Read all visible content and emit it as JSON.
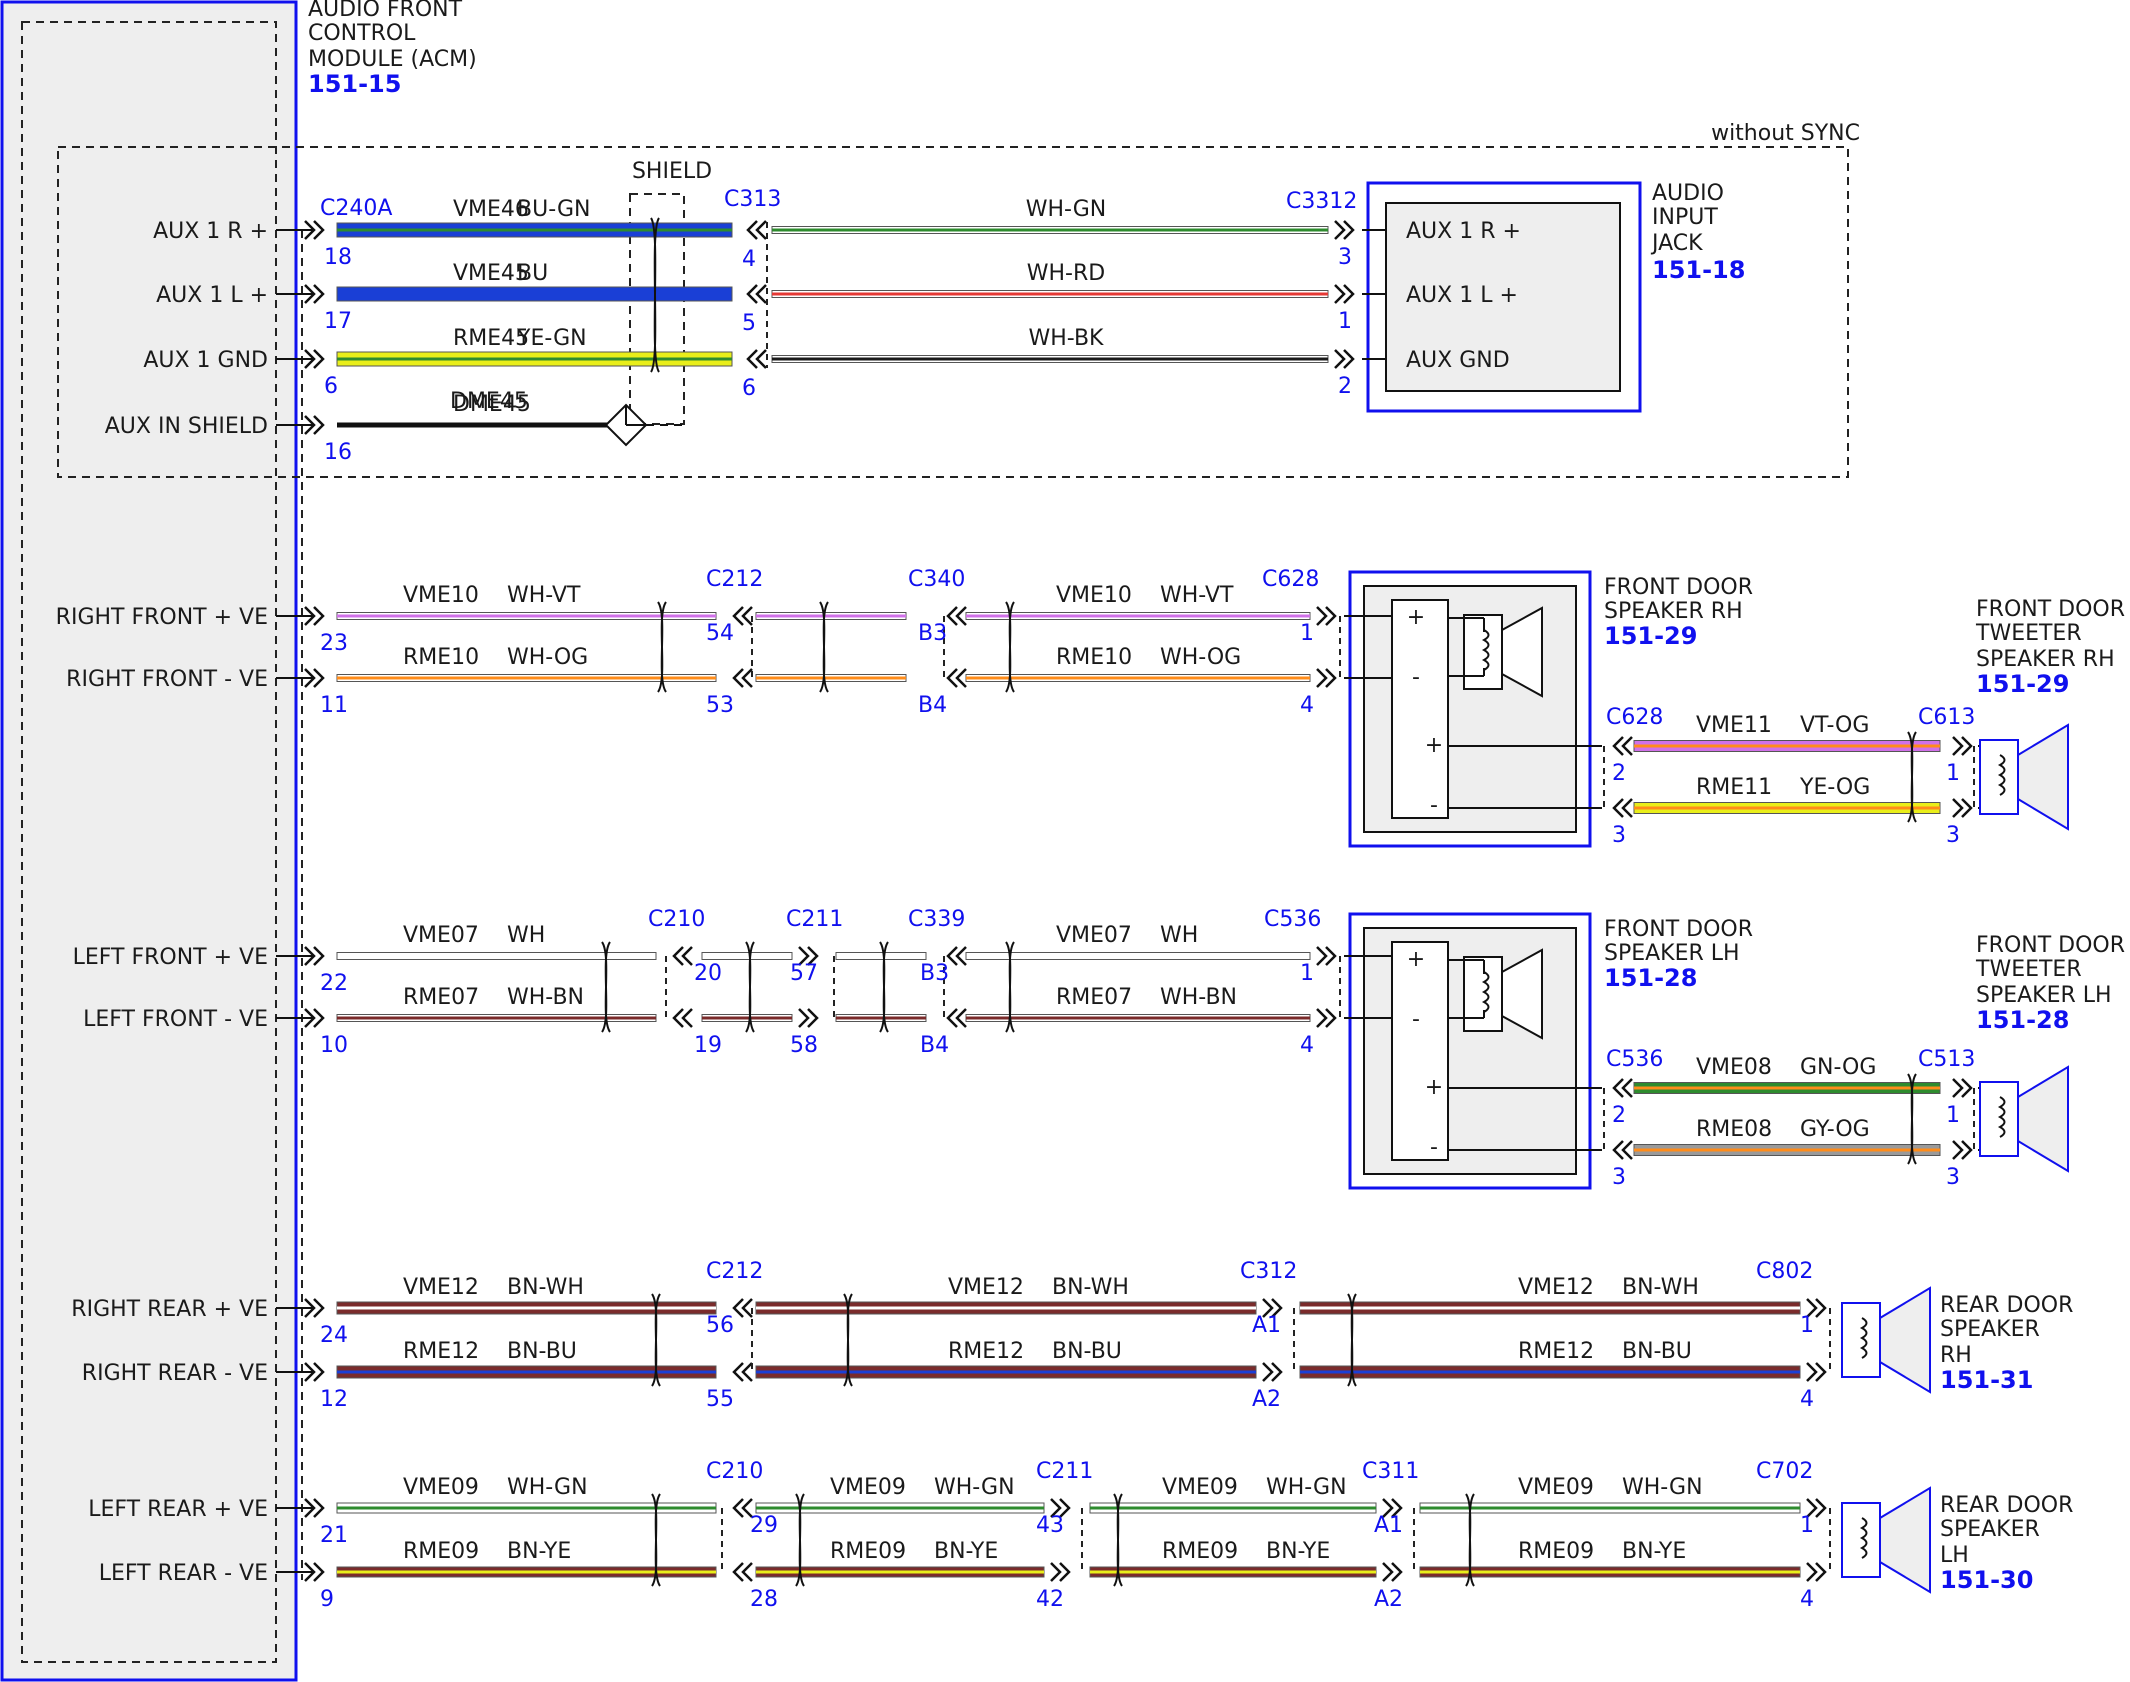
{
  "colors": {
    "WH": "#ffffff",
    "GN": "#2e8b2e",
    "RD": "#e53935",
    "BK": "#1a1a1a",
    "BU": "#1a3fd6",
    "YE": "#e9ee1a",
    "VT": "#d070e8",
    "OG": "#ff8c1a",
    "BN": "#7a2b2b",
    "GY": "#9a9a9a",
    "PK": "#f2a0b8",
    "ui_blue": "#1010ee",
    "module_fill": "#eeeeee"
  },
  "acm": {
    "lines": [
      "AUDIO FRONT",
      "CONTROL",
      "MODULE (ACM)"
    ],
    "ref": "151-15",
    "connector": "C240A"
  },
  "without_sync": "without SYNC",
  "shield_label": "SHIELD",
  "aux_jack": {
    "lines": [
      "AUDIO",
      "INPUT",
      "JACK"
    ],
    "ref": "151-18",
    "connector": "C3312",
    "pins": [
      "AUX 1 R +",
      "AUX 1 L +",
      "AUX GND"
    ]
  },
  "front_rh": {
    "lines": [
      "FRONT DOOR",
      "SPEAKER RH"
    ],
    "ref": "151-29"
  },
  "front_lh": {
    "lines": [
      "FRONT DOOR",
      "SPEAKER LH"
    ],
    "ref": "151-28"
  },
  "tweeter_rh": {
    "lines": [
      "FRONT DOOR",
      "TWEETER",
      "SPEAKER RH"
    ],
    "ref": "151-29"
  },
  "tweeter_lh": {
    "lines": [
      "FRONT DOOR",
      "TWEETER",
      "SPEAKER LH"
    ],
    "ref": "151-28"
  },
  "rear_rh": {
    "lines": [
      "REAR DOOR",
      "SPEAKER",
      "RH"
    ],
    "ref": "151-31"
  },
  "rear_lh": {
    "lines": [
      "REAR DOOR",
      "SPEAKER",
      "LH"
    ],
    "ref": "151-30"
  },
  "symbols": {
    "plus": "+",
    "minus": "-"
  },
  "aux_rows": [
    {
      "label": "AUX 1 R +",
      "pin": "18",
      "circuit": "VME46",
      "color": "BU-GN",
      "far_pin": "4",
      "far_color": "WH-GN",
      "jack_pin": "3"
    },
    {
      "label": "AUX 1 L +",
      "pin": "17",
      "circuit": "VME45",
      "color": "BU",
      "far_pin": "5",
      "far_color": "WH-RD",
      "jack_pin": "1"
    },
    {
      "label": "AUX 1 GND",
      "pin": "6",
      "circuit": "RME45",
      "color": "YE-GN",
      "far_pin": "6",
      "far_color": "WH-BK",
      "jack_pin": "2"
    },
    {
      "label": "AUX IN SHIELD",
      "pin": "16",
      "circuit": "DME45",
      "color": ""
    }
  ],
  "aux_inline": "C313",
  "front_rh_rows": {
    "c1": "C212",
    "c2": "C340",
    "c3": "C628",
    "rows": [
      {
        "label": "RIGHT FRONT + VE",
        "pin": "23",
        "circuit": "VME10",
        "color": "WH-VT",
        "p1": "54",
        "p2": "B3",
        "p3": "1"
      },
      {
        "label": "RIGHT FRONT - VE",
        "pin": "11",
        "circuit": "RME10",
        "color": "WH-OG",
        "p1": "53",
        "p2": "B4",
        "p3": "4"
      }
    ]
  },
  "front_lh_rows": {
    "c1": "C210",
    "c2": "C211",
    "c3": "C339",
    "c4": "C536",
    "rows": [
      {
        "label": "LEFT FRONT + VE",
        "pin": "22",
        "circuit": "VME07",
        "color": "WH",
        "p1": "20",
        "p2": "57",
        "p3": "B3",
        "p4": "1"
      },
      {
        "label": "LEFT FRONT - VE",
        "pin": "10",
        "circuit": "RME07",
        "color": "WH-BN",
        "p1": "19",
        "p2": "58",
        "p3": "B4",
        "p4": "4"
      }
    ]
  },
  "tweeter_rh_rows": {
    "c1": "C628",
    "c2": "C613",
    "rows": [
      {
        "circuit": "VME11",
        "color": "VT-OG",
        "p1": "2",
        "p2": "1"
      },
      {
        "circuit": "RME11",
        "color": "YE-OG",
        "p1": "3",
        "p2": "3"
      }
    ]
  },
  "tweeter_lh_rows": {
    "c1": "C536",
    "c2": "C513",
    "rows": [
      {
        "circuit": "VME08",
        "color": "GN-OG",
        "p1": "2",
        "p2": "1"
      },
      {
        "circuit": "RME08",
        "color": "GY-OG",
        "p1": "3",
        "p2": "3"
      }
    ]
  },
  "rear_rh_rows": {
    "c1": "C212",
    "c2": "C312",
    "c3": "C802",
    "rows": [
      {
        "label": "RIGHT REAR + VE",
        "pin": "24",
        "circuit": "VME12",
        "color": "BN-WH",
        "p1": "56",
        "p2": "A1",
        "p3": "1"
      },
      {
        "label": "RIGHT REAR - VE",
        "pin": "12",
        "circuit": "RME12",
        "color": "BN-BU",
        "p1": "55",
        "p2": "A2",
        "p3": "4"
      }
    ]
  },
  "rear_lh_rows": {
    "c1": "C210",
    "c2": "C211",
    "c3": "C311",
    "c4": "C702",
    "rows": [
      {
        "label": "LEFT REAR + VE",
        "pin": "21",
        "circuit": "VME09",
        "color": "WH-GN",
        "p1": "29",
        "p2": "43",
        "p3": "A1",
        "p4": "1"
      },
      {
        "label": "LEFT REAR - VE",
        "pin": "9",
        "circuit": "RME09",
        "color": "BN-YE",
        "p1": "28",
        "p2": "42",
        "p3": "A2",
        "p4": "4"
      }
    ]
  }
}
